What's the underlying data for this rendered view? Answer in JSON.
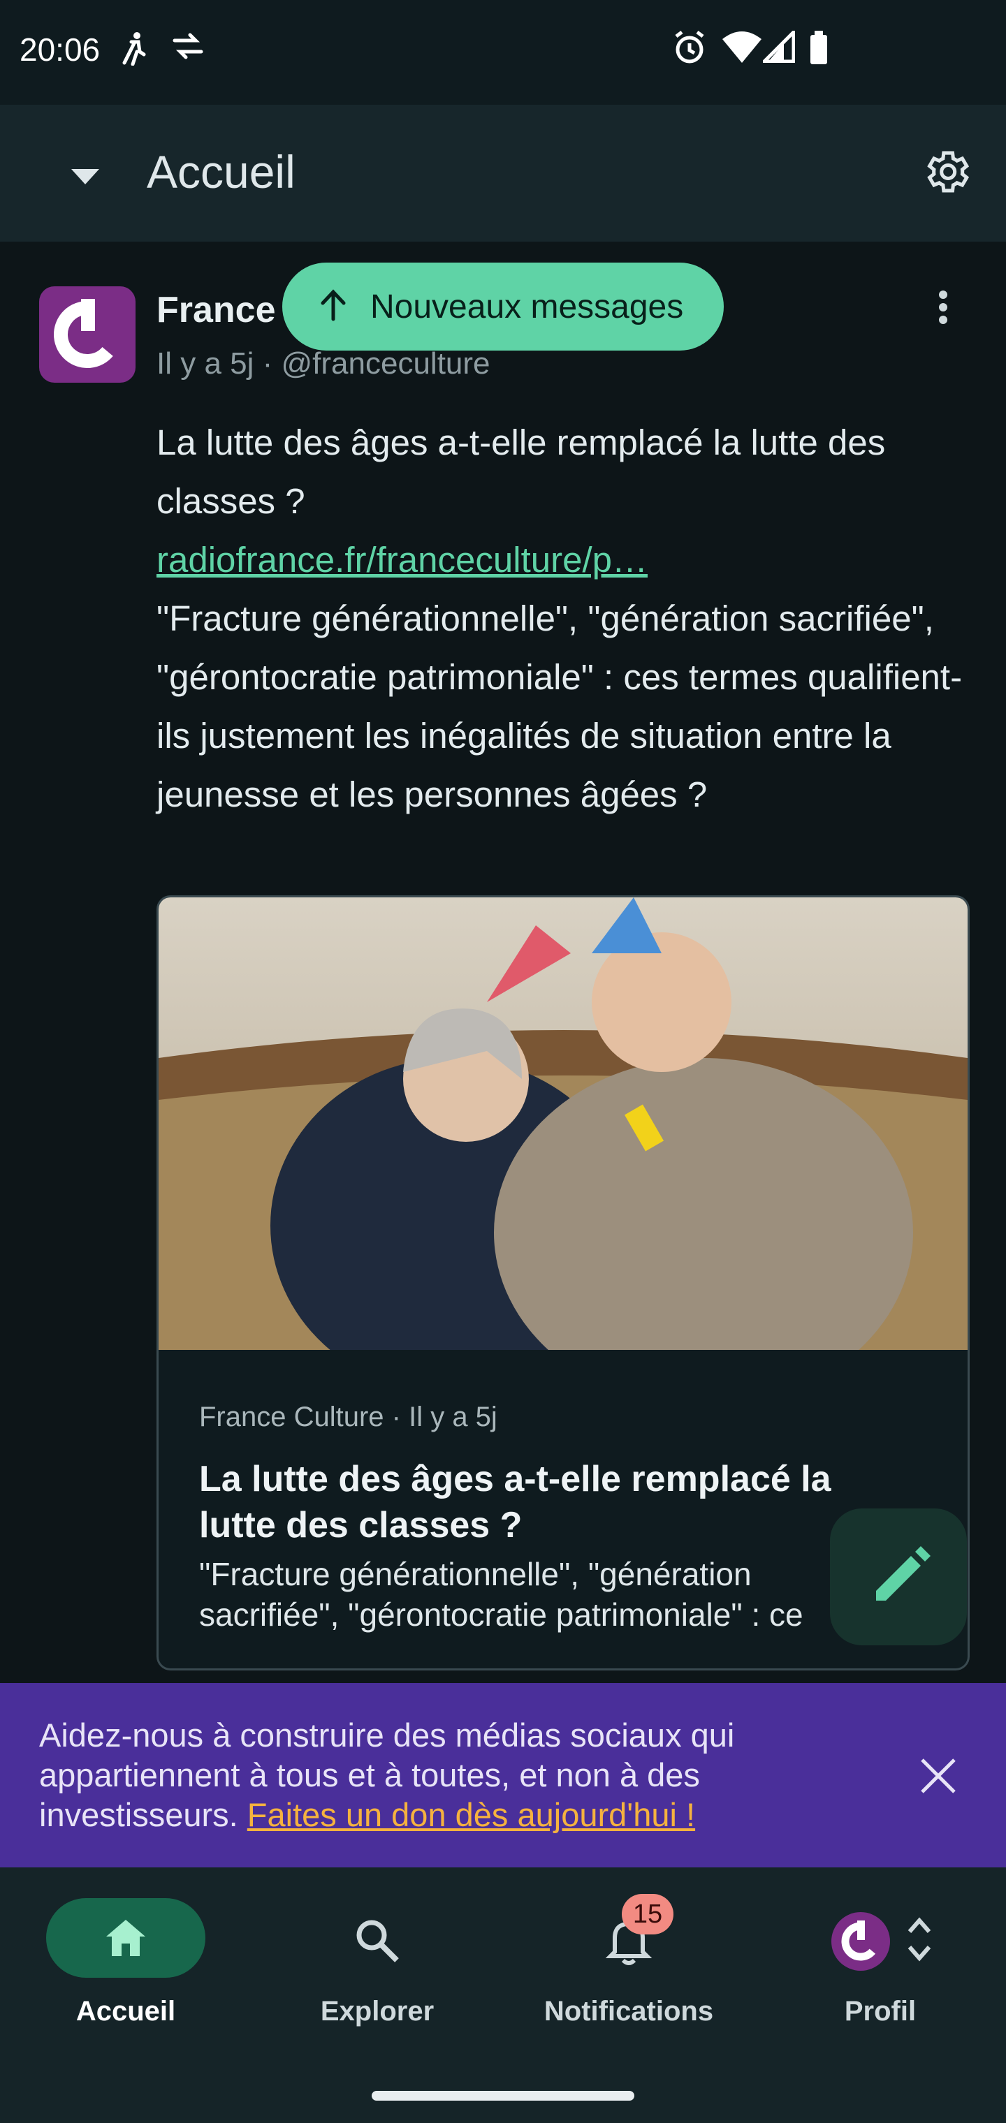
{
  "status_bar": {
    "time": "20:06"
  },
  "app_bar": {
    "title": "Accueil"
  },
  "post": {
    "author": "France",
    "meta": "Il y a 5j · @franceculture",
    "text_line1": "La lutte des âges a-t-elle remplacé la lutte des classes ?",
    "link": "radiofrance.fr/franceculture/p…",
    "text_body": "\"Fracture générationnelle\", \"génération sacrifiée\", \"gérontocratie patrimoniale\" : ces termes qualifient-ils justement les inégalités de situation entre la jeunesse et les personnes âgées ?",
    "card": {
      "meta": "France Culture · Il y a 5j",
      "title": "La lutte des âges a-t-elle remplacé la lutte des classes ?",
      "description": "\"Fracture générationnelle\", \"génération\nsacrifiée\", \"gérontocratie patrimoniale\" : ce"
    }
  },
  "new_messages_button": {
    "label": "Nouveaux messages"
  },
  "donation_banner": {
    "text": "Aidez-nous à construire des médias sociaux qui appartiennent à tous et à toutes, et non à des investisseurs.",
    "link": "Faites un don dès aujourd'hui !"
  },
  "bottom_nav": {
    "items": [
      {
        "label": "Accueil",
        "icon": "home-icon",
        "active": true
      },
      {
        "label": "Explorer",
        "icon": "search-icon"
      },
      {
        "label": "Notifications",
        "icon": "bell-icon",
        "badge": "15"
      },
      {
        "label": "Profil",
        "icon": "avatar"
      }
    ]
  },
  "colors": {
    "accent": "#5fd3a6",
    "banner": "#4a2f9a",
    "link_warn": "#f5b23f"
  }
}
